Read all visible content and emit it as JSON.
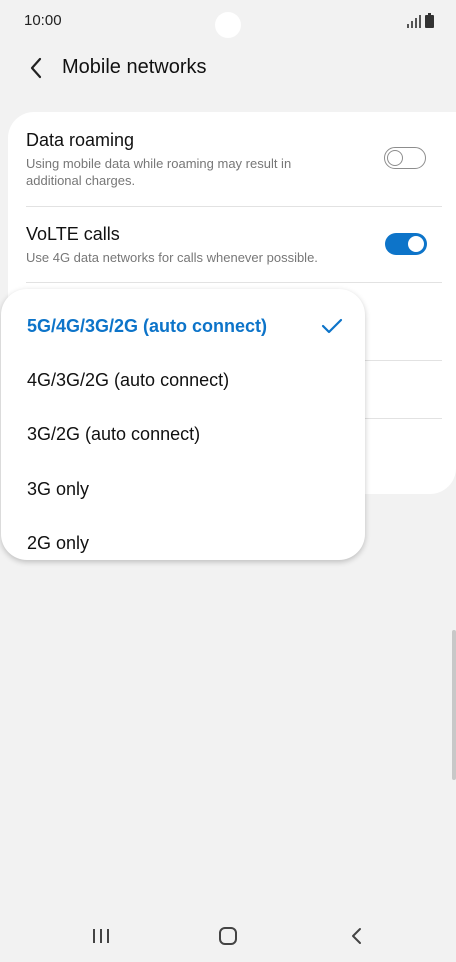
{
  "status_bar": {
    "time": "10:00"
  },
  "header": {
    "title": "Mobile networks"
  },
  "settings": [
    {
      "title": "Data roaming",
      "description": "Using mobile data while roaming may result in additional charges.",
      "toggle_state": "off"
    },
    {
      "title": "VoLTE calls",
      "description": "Use 4G data networks for calls whenever possible.",
      "toggle_state": "on"
    }
  ],
  "network_mode_menu": {
    "options": [
      "5G/4G/3G/2G (auto connect)",
      "4G/3G/2G (auto connect)",
      "3G/2G (auto connect)",
      "3G only",
      "2G only"
    ],
    "selected": "5G/4G/3G/2G (auto connect)"
  },
  "colors": {
    "accent": "#0d74c9",
    "background": "#f2f2f2",
    "card": "#ffffff"
  },
  "icons": {
    "back": "chevron-left-icon",
    "check": "check-icon",
    "nav_recents": "recent-apps-icon",
    "nav_home": "home-icon",
    "nav_back": "back-icon"
  }
}
